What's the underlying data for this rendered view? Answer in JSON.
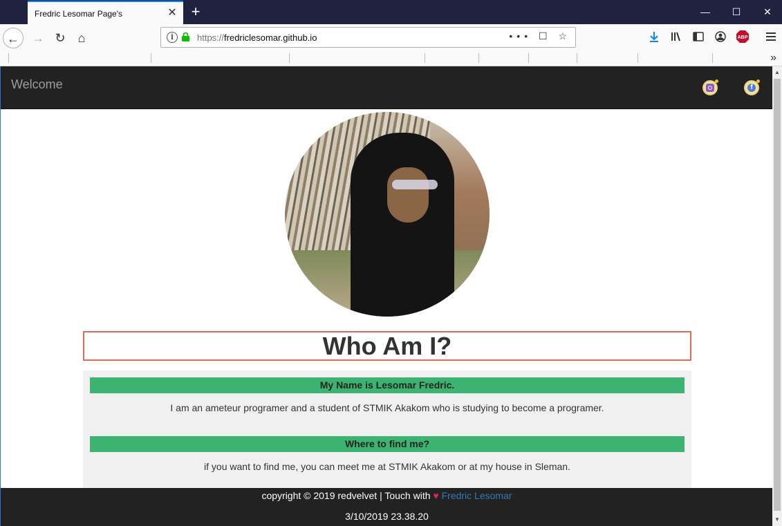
{
  "browser": {
    "tab_title": "Fredric Lesomar Page's",
    "tab_close": "✕",
    "new_tab": "+",
    "url_scheme": "https://",
    "url_host": "fredriclesomar.github.io",
    "url_actions": "••• ☐ ☆",
    "window_controls": {
      "minimize": "—",
      "maximize": "☐",
      "close": "✕"
    },
    "toolbar_icons": [
      "download-icon",
      "library-icon",
      "sidebar-icon",
      "account-icon",
      "adblock-icon",
      "menu-icon"
    ],
    "adblock_label": "ABP",
    "bookmarks_overflow": "»"
  },
  "site": {
    "brand": "Welcome",
    "social": [
      {
        "name": "instagram",
        "glyph": ""
      },
      {
        "name": "facebook",
        "glyph": "f"
      }
    ],
    "who_title": "Who Am I?",
    "sections": [
      {
        "heading": "My Name is Lesomar Fredric.",
        "text": "I am an ameteur programer and a student of STMIK Akakom who is studying to become a programer."
      },
      {
        "heading": "Where to find me?",
        "text": "if you want to find me, you can meet me at STMIK Akakom or at my house in Sleman."
      }
    ],
    "footer": {
      "copyright": "copyright © 2019 redvelvet | Touch with ",
      "heart": "♥",
      "author": "Fredric Lesomar",
      "datetime": "3/10/2019 23.38.20"
    }
  },
  "colors": {
    "header_bg": "#222222",
    "section_heading_bg": "#3cb371",
    "who_box_border": "#e4685a",
    "author_link": "#337ab7"
  }
}
